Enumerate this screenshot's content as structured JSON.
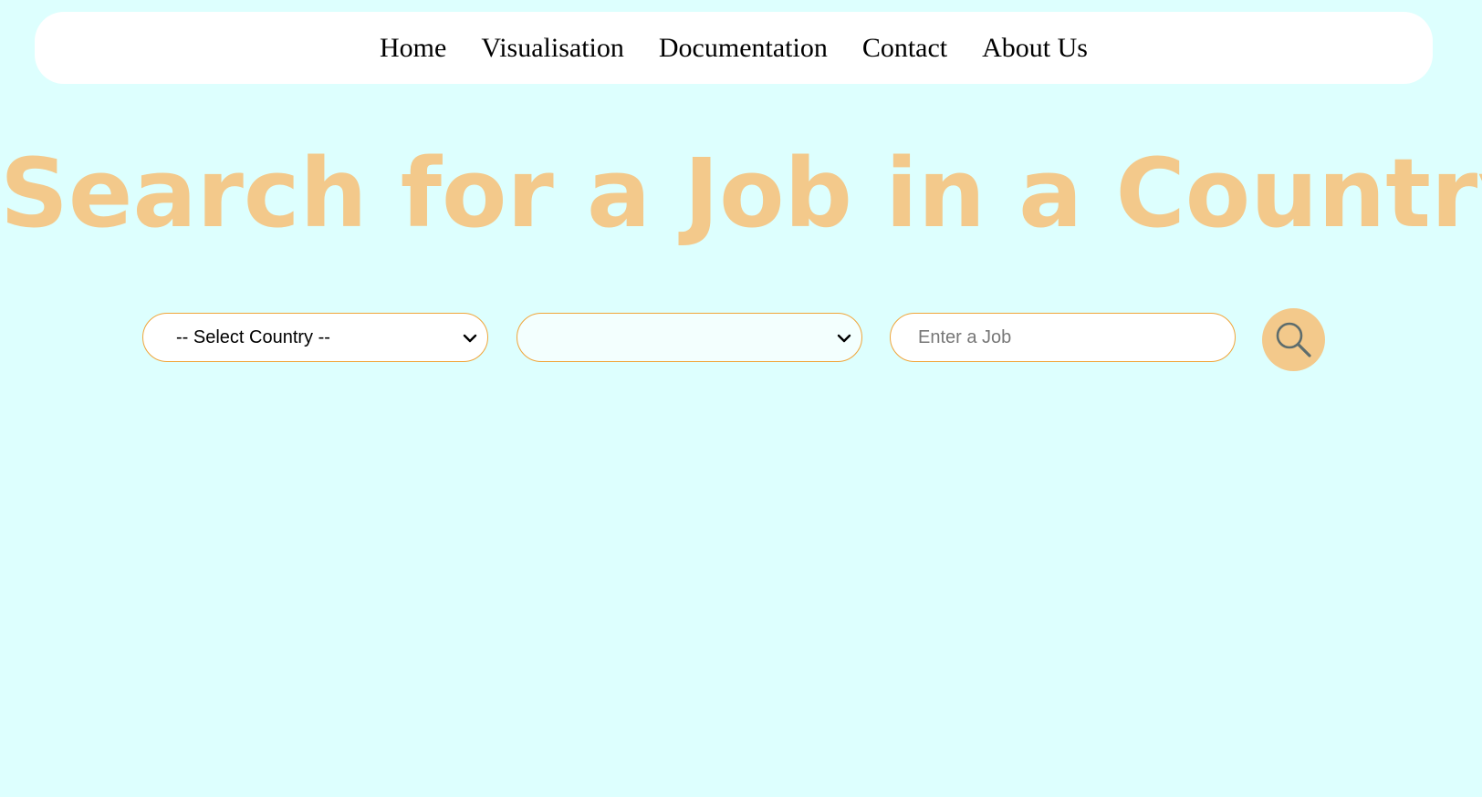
{
  "nav": {
    "items": [
      {
        "label": "Home"
      },
      {
        "label": "Visualisation"
      },
      {
        "label": "Documentation"
      },
      {
        "label": "Contact"
      },
      {
        "label": "About Us"
      }
    ]
  },
  "hero": {
    "title": "Search for a Job in a Country"
  },
  "search": {
    "country_select": {
      "selected": "-- Select Country --"
    },
    "second_select": {
      "selected": ""
    },
    "job_input": {
      "placeholder": "Enter a Job",
      "value": ""
    },
    "search_icon": "search-icon"
  },
  "colors": {
    "background": "#ddfffe",
    "accent": "#f3c98b",
    "border": "#f0a53a",
    "nav_background": "#ffffff",
    "icon_stroke": "#5e6d6d"
  }
}
